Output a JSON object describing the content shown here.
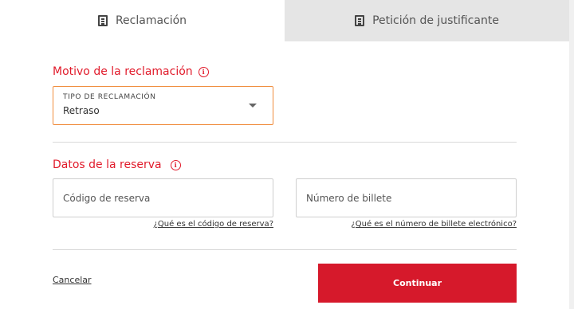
{
  "tabs": [
    {
      "label": "Reclamación",
      "icon": "document-icon"
    },
    {
      "label": "Petición de justificante",
      "icon": "document-icon"
    }
  ],
  "claim_reason": {
    "title": "Motivo de la reclamación",
    "select_label": "TIPO DE RECLAMACIÓN",
    "select_value": "Retraso"
  },
  "booking": {
    "title": "Datos de la reserva",
    "reservation_code_placeholder": "Código de reserva",
    "ticket_number_placeholder": "Número de billete",
    "reservation_code_help": "¿Qué es el código de reserva?",
    "ticket_number_help": "¿Qué es el número de billete electrónico?"
  },
  "actions": {
    "cancel_label": "Cancelar",
    "continue_label": "Continuar"
  },
  "colors": {
    "accent_red": "#e11b2b",
    "button_red": "#d6192b",
    "focus_orange": "#f08c3c",
    "inactive_tab_bg": "#e5e5e5"
  }
}
